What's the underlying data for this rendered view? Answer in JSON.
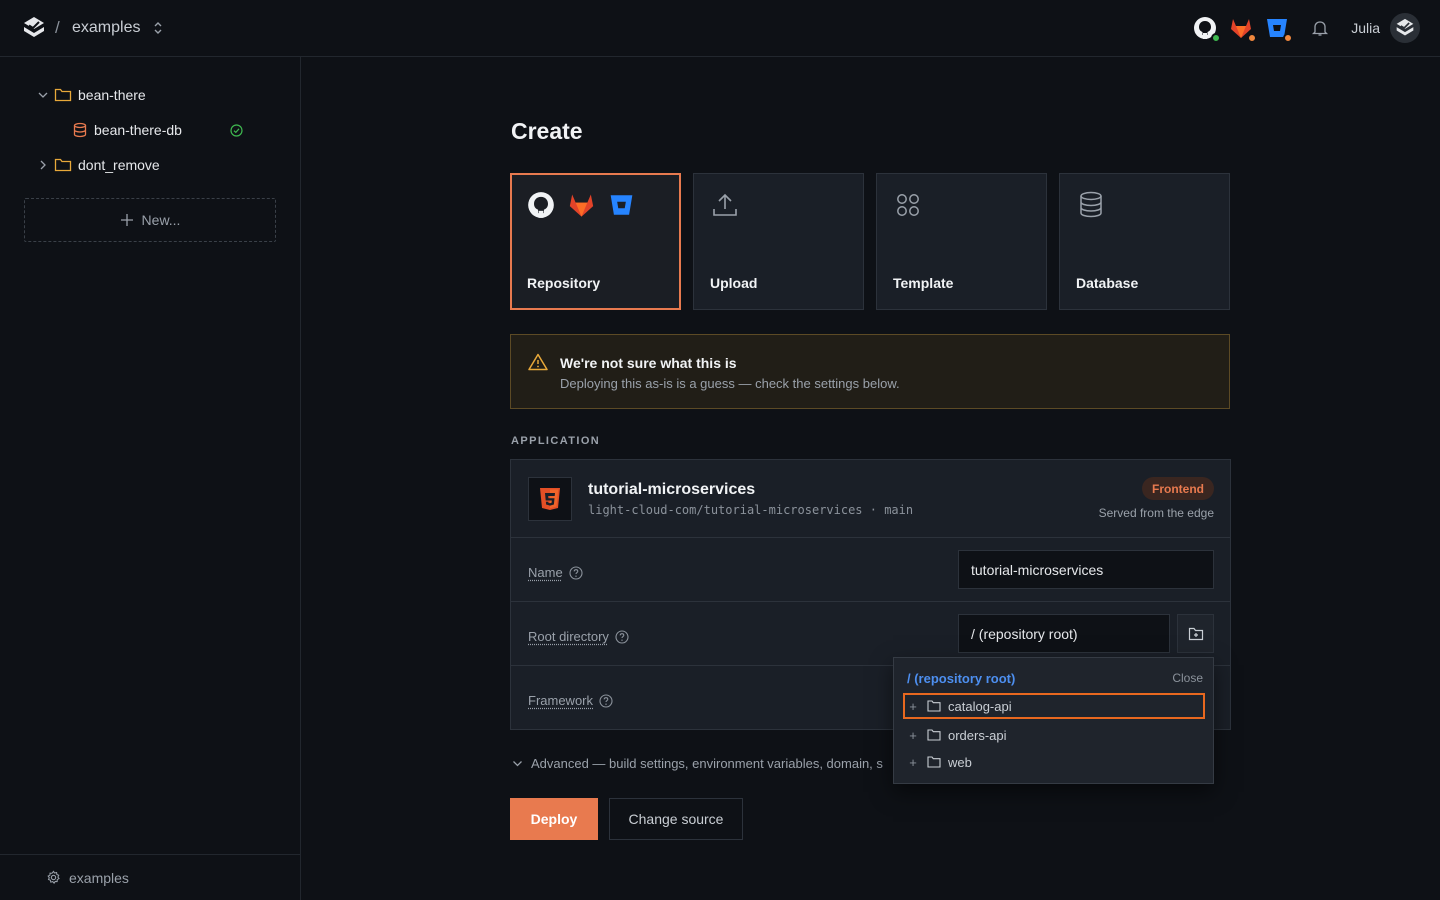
{
  "topbar": {
    "separator": "/",
    "project": "examples",
    "user": "Julia",
    "providers": [
      {
        "name": "github-icon",
        "status_color": "#3fb950"
      },
      {
        "name": "gitlab-icon",
        "status_color": "#f0883e"
      },
      {
        "name": "bitbucket-icon",
        "status_color": "#f0883e"
      }
    ]
  },
  "sidebar": {
    "tree": [
      {
        "label": "bean-there",
        "type": "folder",
        "expanded": true
      },
      {
        "label": "bean-there-db",
        "type": "database",
        "status": "ok"
      },
      {
        "label": "dont_remove",
        "type": "folder",
        "expanded": false
      }
    ],
    "new_label": "New...",
    "footer_label": "examples"
  },
  "main": {
    "title": "Create",
    "source_cards": [
      {
        "label": "Repository",
        "selected": true
      },
      {
        "label": "Upload",
        "selected": false
      },
      {
        "label": "Template",
        "selected": false
      },
      {
        "label": "Database",
        "selected": false
      }
    ],
    "warning": {
      "title": "We're not sure what this is",
      "text": "Deploying this as-is is a guess — check the settings below."
    },
    "section_label": "APPLICATION",
    "app": {
      "name": "tutorial-microservices",
      "repo": "light-cloud-com/tutorial-microservices · main",
      "badge": "Frontend",
      "subtitle": "Served from the edge"
    },
    "fields": {
      "name_label": "Name",
      "name_value": "tutorial-microservices",
      "root_label": "Root directory",
      "root_value": "/ (repository root)",
      "framework_label": "Framework"
    },
    "advanced_label": "Advanced — build settings, environment variables, domain, s",
    "deploy_label": "Deploy",
    "change_source_label": "Change source"
  },
  "dropdown": {
    "path": "/ (repository root)",
    "close_label": "Close",
    "items": [
      {
        "label": "catalog-api",
        "active": true
      },
      {
        "label": "orders-api",
        "active": false
      },
      {
        "label": "web",
        "active": false
      }
    ]
  },
  "colors": {
    "accent": "#e87a4f",
    "link": "#4d8ff0",
    "success": "#3fb950",
    "warning": "#e8a93a"
  }
}
